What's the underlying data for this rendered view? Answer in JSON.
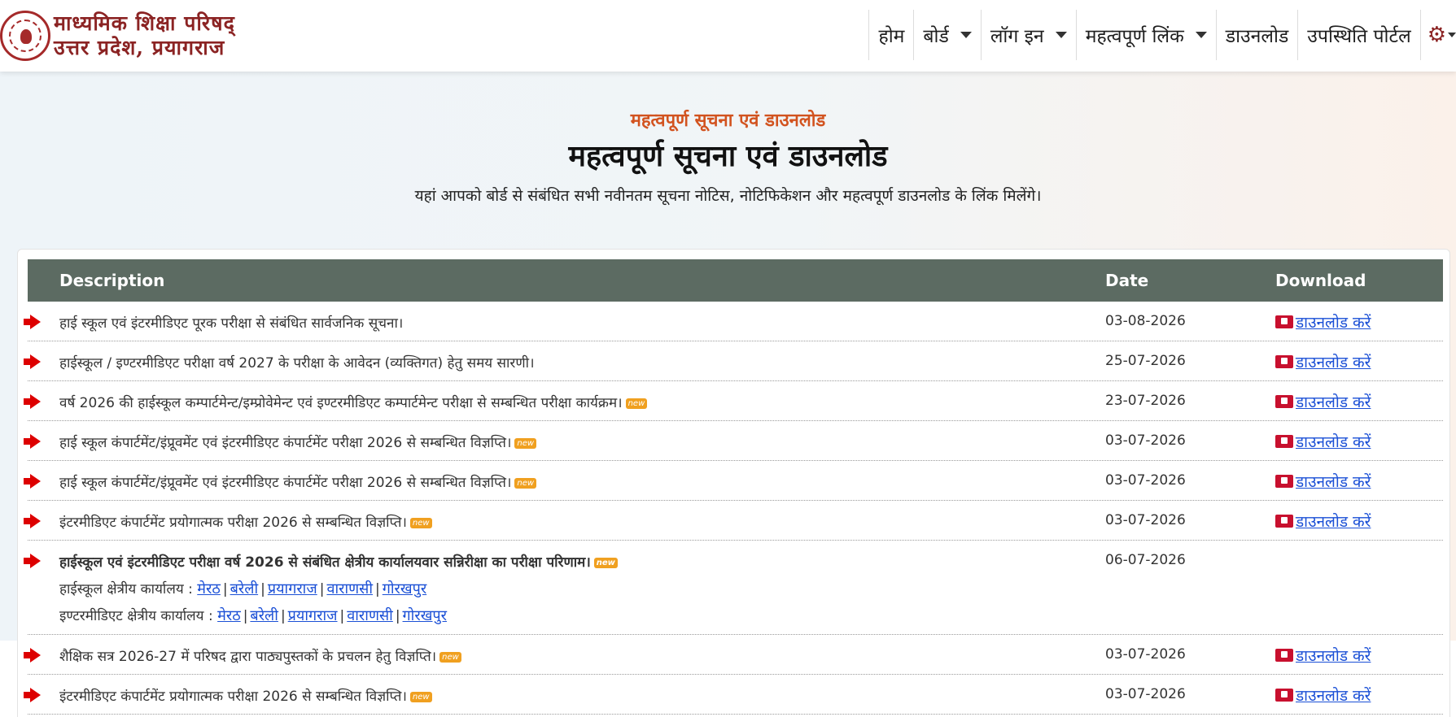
{
  "logo": {
    "line1": "माध्यमिक शिक्षा परिषद्",
    "line2": "उत्तर प्रदेश, प्रयागराज"
  },
  "nav": {
    "items": [
      {
        "label": "होम",
        "dropdown": false
      },
      {
        "label": "बोर्ड",
        "dropdown": true
      },
      {
        "label": "लॉग इन",
        "dropdown": true
      },
      {
        "label": "महत्वपूर्ण लिंक",
        "dropdown": true
      },
      {
        "label": "डाउनलोड",
        "dropdown": false
      },
      {
        "label": "उपस्थिति पोर्टल",
        "dropdown": false
      }
    ],
    "settings_icon": "gear-icon"
  },
  "hero": {
    "eyebrow": "महत्वपूर्ण सूचना एवं डाउनलोड",
    "title": "महत्वपूर्ण सूचना एवं डाउनलोड",
    "subtitle": "यहां आपको बोर्ड से संबंधित सभी नवीनतम सूचना नोटिस, नोटिफिकेशन और महत्वपूर्ण डाउनलोड के लिंक मिलेंगे।"
  },
  "table": {
    "headers": {
      "description": "Description",
      "date": "Date",
      "download": "Download"
    },
    "new_badge": "new",
    "download_label": "डाउनलोड करें",
    "rows": [
      {
        "description": "हाई स्कूल एवं इंटरमीडिएट पूरक परीक्षा से संबंधित सार्वजनिक सूचना।",
        "date": "03-08-2026"
      },
      {
        "description": "हाईस्कूल / इण्टरमीडिएट परीक्षा वर्ष 2027 के परीक्षा के आवेदन (व्यक्तिगत) हेतु समय सारणी।",
        "date": "25-07-2026"
      },
      {
        "description": "वर्ष 2026 की हाईस्कूल कम्पार्टमेन्ट/इम्प्रोवेमेन्ट एवं इण्टरमीडिएट कम्पार्टमेन्ट परीक्षा से सम्बन्धित परीक्षा कार्यक्रम।",
        "date": "23-07-2026"
      },
      {
        "description": "हाई स्कूल कंपार्टमेंट/इंप्रूवमेंट एवं इंटरमीडिएट कंपार्टमेंट परीक्षा 2026 से सम्बन्धित विज्ञप्ति।",
        "date": "03-07-2026"
      },
      {
        "description": "हाई स्कूल कंपार्टमेंट/इंप्रूवमेंट एवं इंटरमीडिएट कंपार्टमेंट परीक्षा 2026 से सम्बन्धित विज्ञप्ति।",
        "date": "03-07-2026"
      },
      {
        "description": "इंटरमीडिएट कंपार्टमेंट प्रयोगात्मक परीक्षा 2026 से सम्बन्धित विज्ञप्ति।",
        "date": "03-07-2026"
      },
      {
        "description": "हाईस्कूल एवं इंटरमीडिएट परीक्षा वर्ष 2026 से संबंधित क्षेत्रीय कार्यालयवार सन्निरीक्षा का परीक्षा परिणाम।",
        "date": "06-07-2026",
        "highschool_label": "हाईस्कूल क्षेत्रीय कार्यालय :",
        "intermediate_label": "इण्टरमीडिएट क्षेत्रीय कार्यालय :",
        "regions": [
          "मेरठ",
          "बरेली",
          "प्रयागराज",
          "वाराणसी",
          "गोरखपुर"
        ],
        "separator": "|"
      },
      {
        "description": "शैक्षिक सत्र 2026-27 में परिषद द्वारा पाठ्यपुस्तकों के प्रचलन हेतु विज्ञप्ति।",
        "date": "03-07-2026"
      },
      {
        "description": "इंटरमीडिएट कंपार्टमेंट प्रयोगात्मक परीक्षा 2026 से सम्बन्धित विज्ञप्ति।",
        "date": "03-07-2026"
      }
    ]
  }
}
